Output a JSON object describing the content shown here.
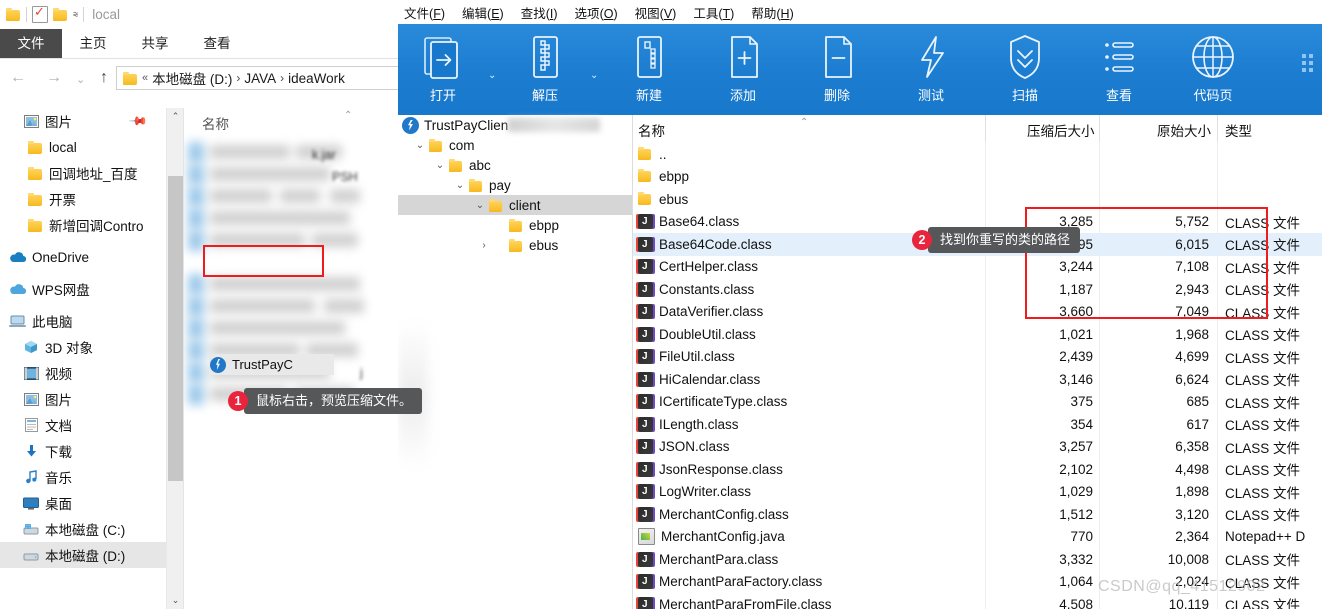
{
  "explorer": {
    "titlebar": {
      "quick_access": [
        "folder-icon",
        "properties-icon",
        "new-folder-icon",
        "customize-caret"
      ],
      "title": "local"
    },
    "ribbon_tabs": [
      {
        "label": "文件",
        "active": true
      },
      {
        "label": "主页",
        "active": false
      },
      {
        "label": "共享",
        "active": false
      },
      {
        "label": "查看",
        "active": false
      }
    ],
    "nav_buttons": {
      "back": "←",
      "forward": "→",
      "recent": "⌄",
      "up": "↑"
    },
    "address_bar": {
      "root_icon": "folder-icon",
      "overflow": "«",
      "crumbs": [
        "本地磁盘 (D:)",
        "JAVA",
        "ideaWork"
      ]
    },
    "nav_pane": {
      "items": [
        {
          "label": "图片",
          "icon": "picture-icon",
          "indent": 1,
          "pinned": true
        },
        {
          "label": "local",
          "icon": "folder-icon",
          "indent": 1
        },
        {
          "label": "回调地址_百度",
          "icon": "folder-icon",
          "indent": 1
        },
        {
          "label": "开票",
          "icon": "folder-icon",
          "indent": 1
        },
        {
          "label": "新增回调Contro",
          "icon": "folder-icon",
          "indent": 1
        },
        {
          "label": "OneDrive",
          "icon": "onedrive-cloud-icon",
          "indent": 0
        },
        {
          "label": "WPS网盘",
          "icon": "wps-cloud-icon",
          "indent": 0
        },
        {
          "label": "此电脑",
          "icon": "this-pc-icon",
          "indent": 0
        },
        {
          "label": "3D 对象",
          "icon": "3d-object-icon",
          "indent": 1
        },
        {
          "label": "视频",
          "icon": "video-icon",
          "indent": 1
        },
        {
          "label": "图片",
          "icon": "picture-icon",
          "indent": 1
        },
        {
          "label": "文档",
          "icon": "document-icon",
          "indent": 1
        },
        {
          "label": "下载",
          "icon": "download-icon",
          "indent": 1
        },
        {
          "label": "音乐",
          "icon": "music-icon",
          "indent": 1
        },
        {
          "label": "桌面",
          "icon": "desktop-icon",
          "indent": 1
        },
        {
          "label": "本地磁盘 (C:)",
          "icon": "system-drive-icon",
          "indent": 1
        },
        {
          "label": "本地磁盘 (D:)",
          "icon": "drive-icon",
          "indent": 1,
          "selected": true
        }
      ],
      "scrollbar": {
        "up": "⌃",
        "down": "⌄"
      }
    },
    "content_pane": {
      "column_header": "名称",
      "sort_arrow": "⌃",
      "selected_file": {
        "label": "TrustPayC",
        "icon": "jar-icon"
      },
      "obscured_fragments": [
        "k.jar",
        "PSH",
        "j"
      ]
    }
  },
  "archive": {
    "menu": [
      {
        "label": "文件",
        "accel": "F"
      },
      {
        "label": "编辑",
        "accel": "E"
      },
      {
        "label": "查找",
        "accel": "I"
      },
      {
        "label": "选项",
        "accel": "O"
      },
      {
        "label": "视图",
        "accel": "V"
      },
      {
        "label": "工具",
        "accel": "T"
      },
      {
        "label": "帮助",
        "accel": "H"
      }
    ],
    "toolbar": [
      {
        "label": "打开",
        "icon": "open-archive-icon",
        "has_caret": true
      },
      {
        "label": "解压",
        "icon": "extract-icon",
        "has_caret": true
      },
      {
        "label": "新建",
        "icon": "new-archive-icon",
        "has_caret": false
      },
      {
        "label": "添加",
        "icon": "add-file-icon",
        "has_caret": false
      },
      {
        "label": "删除",
        "icon": "delete-file-icon",
        "has_caret": false
      },
      {
        "label": "测试",
        "icon": "test-lightning-icon",
        "has_caret": false
      },
      {
        "label": "扫描",
        "icon": "scan-shield-icon",
        "has_caret": false
      },
      {
        "label": "查看",
        "icon": "view-list-icon",
        "has_caret": false
      },
      {
        "label": "代码页",
        "icon": "codepage-globe-icon",
        "has_caret": false
      }
    ],
    "tree": [
      {
        "label": "TrustPayClien",
        "icon": "archive-root-icon",
        "depth": 0,
        "chevron": "",
        "blurred_suffix": true
      },
      {
        "label": "com",
        "icon": "folder-icon",
        "depth": 1,
        "chevron": "⌄"
      },
      {
        "label": "abc",
        "icon": "folder-icon",
        "depth": 2,
        "chevron": "⌄"
      },
      {
        "label": "pay",
        "icon": "folder-icon",
        "depth": 3,
        "chevron": "⌄"
      },
      {
        "label": "client",
        "icon": "folder-icon",
        "depth": 4,
        "chevron": "⌄",
        "selected": true
      },
      {
        "label": "ebpp",
        "icon": "folder-icon",
        "depth": 5,
        "chevron": ""
      },
      {
        "label": "ebus",
        "icon": "folder-icon",
        "depth": 5,
        "chevron": "›"
      }
    ],
    "list_headers": {
      "name": "名称",
      "packed_size": "压缩后大小",
      "original_size": "原始大小",
      "type": "类型",
      "sort_arrow": "⌃"
    },
    "files": [
      {
        "name": "..",
        "icon": "folder-icon",
        "packed": "",
        "size": "",
        "type": ""
      },
      {
        "name": "ebpp",
        "icon": "folder-icon",
        "packed": "",
        "size": "",
        "type": ""
      },
      {
        "name": "ebus",
        "icon": "folder-icon",
        "packed": "",
        "size": "",
        "type": ""
      },
      {
        "name": "Base64.class",
        "icon": "class-icon",
        "packed": "3,285",
        "size": "5,752",
        "type": "CLASS 文件"
      },
      {
        "name": "Base64Code.class",
        "icon": "class-icon",
        "packed": "3,195",
        "size": "6,015",
        "type": "CLASS 文件",
        "selected": true
      },
      {
        "name": "CertHelper.class",
        "icon": "class-icon",
        "packed": "3,244",
        "size": "7,108",
        "type": "CLASS 文件"
      },
      {
        "name": "Constants.class",
        "icon": "class-icon",
        "packed": "1,187",
        "size": "2,943",
        "type": "CLASS 文件"
      },
      {
        "name": "DataVerifier.class",
        "icon": "class-icon",
        "packed": "3,660",
        "size": "7,049",
        "type": "CLASS 文件"
      },
      {
        "name": "DoubleUtil.class",
        "icon": "class-icon",
        "packed": "1,021",
        "size": "1,968",
        "type": "CLASS 文件"
      },
      {
        "name": "FileUtil.class",
        "icon": "class-icon",
        "packed": "2,439",
        "size": "4,699",
        "type": "CLASS 文件"
      },
      {
        "name": "HiCalendar.class",
        "icon": "class-icon",
        "packed": "3,146",
        "size": "6,624",
        "type": "CLASS 文件"
      },
      {
        "name": "ICertificateType.class",
        "icon": "class-icon",
        "packed": "375",
        "size": "685",
        "type": "CLASS 文件"
      },
      {
        "name": "ILength.class",
        "icon": "class-icon",
        "packed": "354",
        "size": "617",
        "type": "CLASS 文件"
      },
      {
        "name": "JSON.class",
        "icon": "class-icon",
        "packed": "3,257",
        "size": "6,358",
        "type": "CLASS 文件"
      },
      {
        "name": "JsonResponse.class",
        "icon": "class-icon",
        "packed": "2,102",
        "size": "4,498",
        "type": "CLASS 文件"
      },
      {
        "name": "LogWriter.class",
        "icon": "class-icon",
        "packed": "1,029",
        "size": "1,898",
        "type": "CLASS 文件"
      },
      {
        "name": "MerchantConfig.class",
        "icon": "class-icon",
        "packed": "1,512",
        "size": "3,120",
        "type": "CLASS 文件"
      },
      {
        "name": "MerchantConfig.java",
        "icon": "notepadpp-icon",
        "packed": "770",
        "size": "2,364",
        "type": "Notepad++ D"
      },
      {
        "name": "MerchantPara.class",
        "icon": "class-icon",
        "packed": "3,332",
        "size": "10,008",
        "type": "CLASS 文件"
      },
      {
        "name": "MerchantParaFactory.class",
        "icon": "class-icon",
        "packed": "1,064",
        "size": "2,024",
        "type": "CLASS 文件"
      },
      {
        "name": "MerchantParaFromFile.class",
        "icon": "class-icon",
        "packed": "4,508",
        "size": "10,119",
        "type": "CLASS 文件"
      }
    ]
  },
  "callouts": [
    {
      "number": "1",
      "text": "鼠标右击，预览压缩文件。"
    },
    {
      "number": "2",
      "text": "找到你重写的类的路径"
    }
  ],
  "watermark": "CSDN@qq_41512902",
  "colors": {
    "toolbar_blue": "#1878cc",
    "highlight_red": "#ee1c1c",
    "callout_badge": "#e8253d",
    "callout_bubble": "#555759",
    "row_selected": "#e3effb"
  }
}
